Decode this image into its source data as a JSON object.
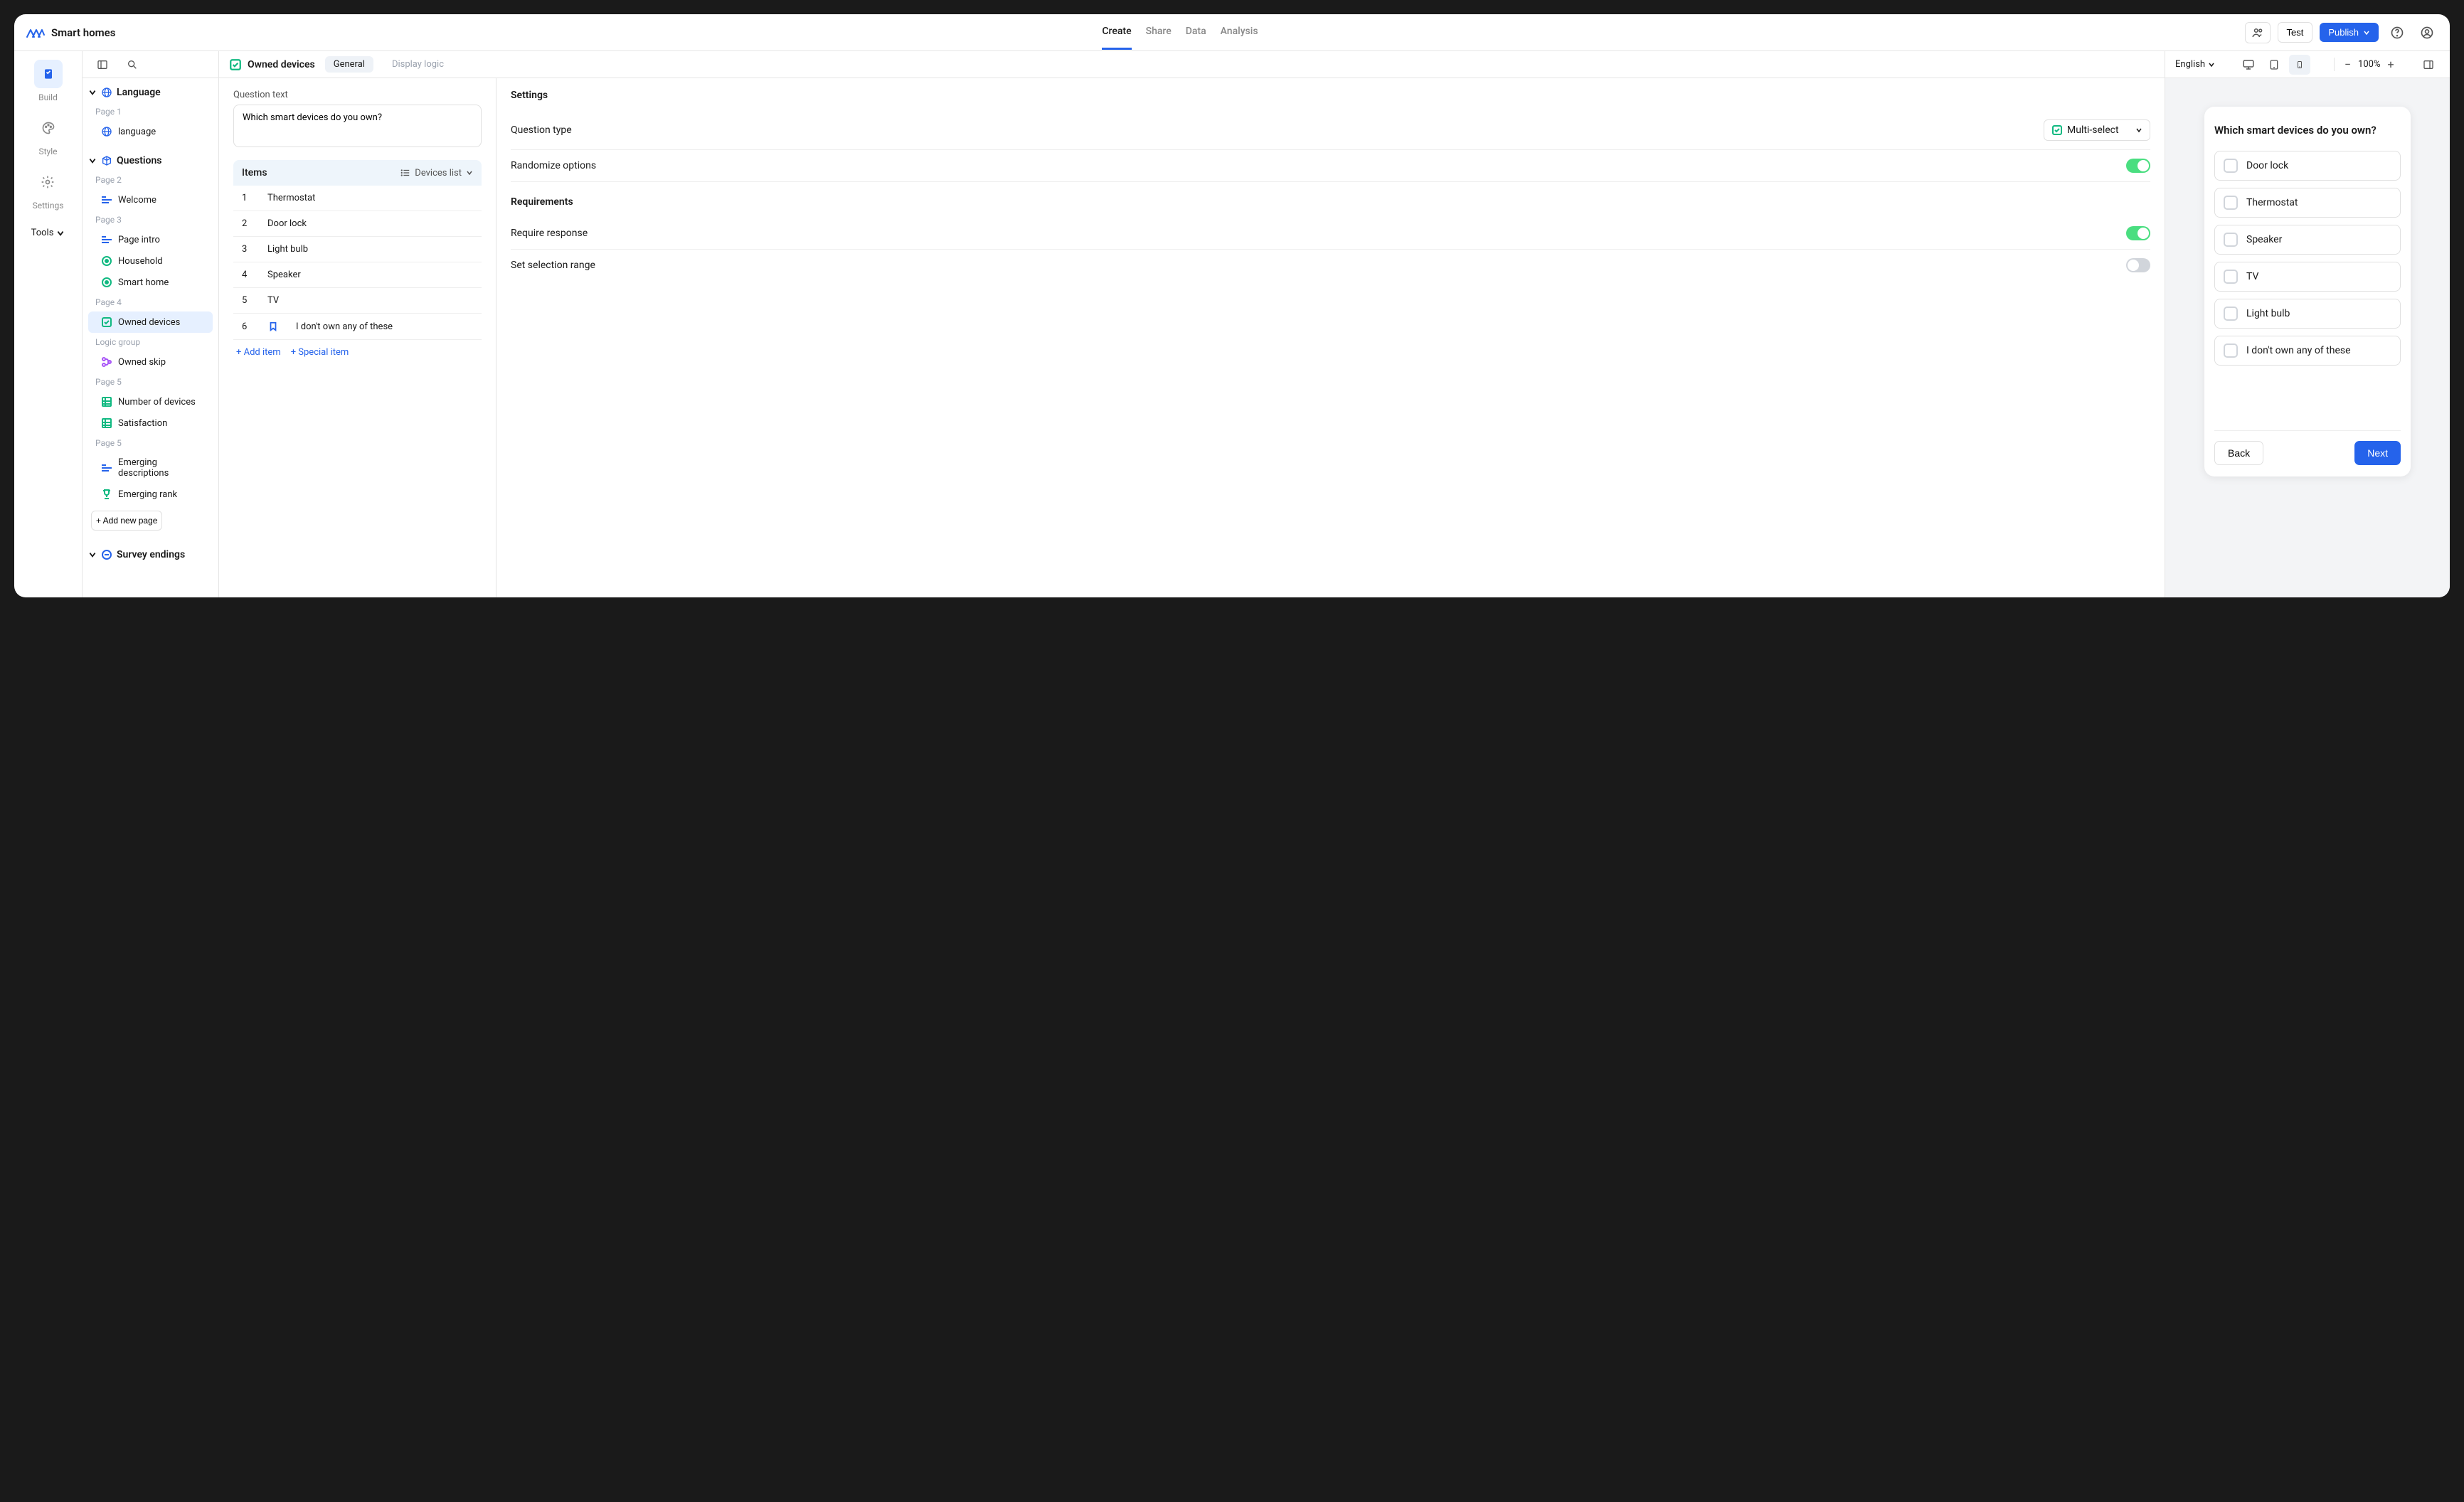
{
  "project": {
    "name": "Smart homes"
  },
  "nav": {
    "create": "Create",
    "share": "Share",
    "data": "Data",
    "analysis": "Analysis"
  },
  "topbar": {
    "test": "Test",
    "publish": "Publish"
  },
  "leftbar": {
    "build": "Build",
    "style": "Style",
    "settings": "Settings",
    "tools": "Tools"
  },
  "outline": {
    "sections": {
      "language": {
        "title": "Language",
        "page1": "Page 1",
        "item0": "language"
      },
      "questions": {
        "title": "Questions",
        "page2": "Page 2",
        "item_welcome": "Welcome",
        "page3": "Page 3",
        "item_intro": "Page intro",
        "item_household": "Household",
        "item_smart": "Smart home",
        "page4": "Page 4",
        "item_owned": "Owned devices",
        "logic_group": "Logic group",
        "item_skip": "Owned skip",
        "page5a": "Page 5",
        "item_num": "Number of devices",
        "item_sat": "Satisfaction",
        "page5b": "Page 5",
        "item_emerg_desc": "Emerging descriptions",
        "item_emerg_rank": "Emerging rank"
      },
      "endings": {
        "title": "Survey endings"
      }
    },
    "add_page": "+ Add new page"
  },
  "editor": {
    "title": "Owned devices",
    "tabs": {
      "general": "General",
      "logic": "Display logic"
    },
    "question_label": "Question text",
    "question_text": "Which smart devices do you own?",
    "items_label": "Items",
    "items_source": "Devices list",
    "items": [
      {
        "idx": "1",
        "label": "Thermostat",
        "special": false
      },
      {
        "idx": "2",
        "label": "Door lock",
        "special": false
      },
      {
        "idx": "3",
        "label": "Light bulb",
        "special": false
      },
      {
        "idx": "4",
        "label": "Speaker",
        "special": false
      },
      {
        "idx": "5",
        "label": "TV",
        "special": false
      },
      {
        "idx": "6",
        "label": "I don't own any of these",
        "special": true
      }
    ],
    "add_item": "+ Add item",
    "add_special": "+ Special item"
  },
  "settings": {
    "title": "Settings",
    "qtype_label": "Question type",
    "qtype_value": "Multi-select",
    "randomize": "Randomize options",
    "requirements_title": "Requirements",
    "require_response": "Require response",
    "selection_range": "Set selection range"
  },
  "preview": {
    "language": "English",
    "zoom": "100%",
    "question": "Which smart devices do you own?",
    "options": [
      "Door lock",
      "Thermostat",
      "Speaker",
      "TV",
      "Light bulb",
      "I don't own any of these"
    ],
    "back": "Back",
    "next": "Next"
  }
}
